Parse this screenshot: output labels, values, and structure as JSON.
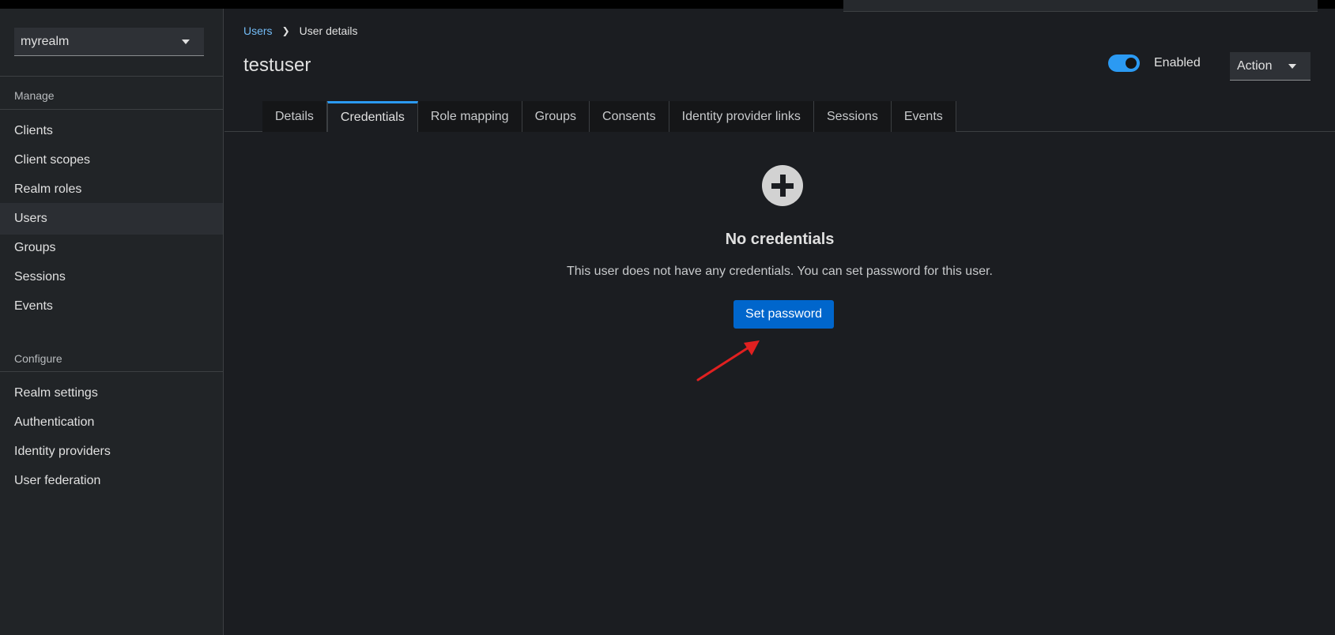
{
  "realm": {
    "selected": "myrealm"
  },
  "sidebar": {
    "manage_title": "Manage",
    "manage_items": [
      {
        "label": "Clients"
      },
      {
        "label": "Client scopes"
      },
      {
        "label": "Realm roles"
      },
      {
        "label": "Users",
        "active": true
      },
      {
        "label": "Groups"
      },
      {
        "label": "Sessions"
      },
      {
        "label": "Events"
      }
    ],
    "configure_title": "Configure",
    "configure_items": [
      {
        "label": "Realm settings"
      },
      {
        "label": "Authentication"
      },
      {
        "label": "Identity providers"
      },
      {
        "label": "User federation"
      }
    ]
  },
  "breadcrumb": {
    "parent": "Users",
    "current": "User details"
  },
  "header": {
    "title": "testuser",
    "enabled_label": "Enabled",
    "enabled": true,
    "action_label": "Action"
  },
  "tabs": [
    {
      "label": "Details"
    },
    {
      "label": "Credentials",
      "active": true
    },
    {
      "label": "Role mapping"
    },
    {
      "label": "Groups"
    },
    {
      "label": "Consents"
    },
    {
      "label": "Identity provider links"
    },
    {
      "label": "Sessions"
    },
    {
      "label": "Events"
    }
  ],
  "empty_state": {
    "icon": "plus-circle-icon",
    "title": "No credentials",
    "body": "This user does not have any credentials. You can set password for this user.",
    "button": "Set password"
  },
  "colors": {
    "accent": "#2b9af3",
    "primary_button": "#0066cc",
    "annotation_arrow": "#e02020"
  }
}
